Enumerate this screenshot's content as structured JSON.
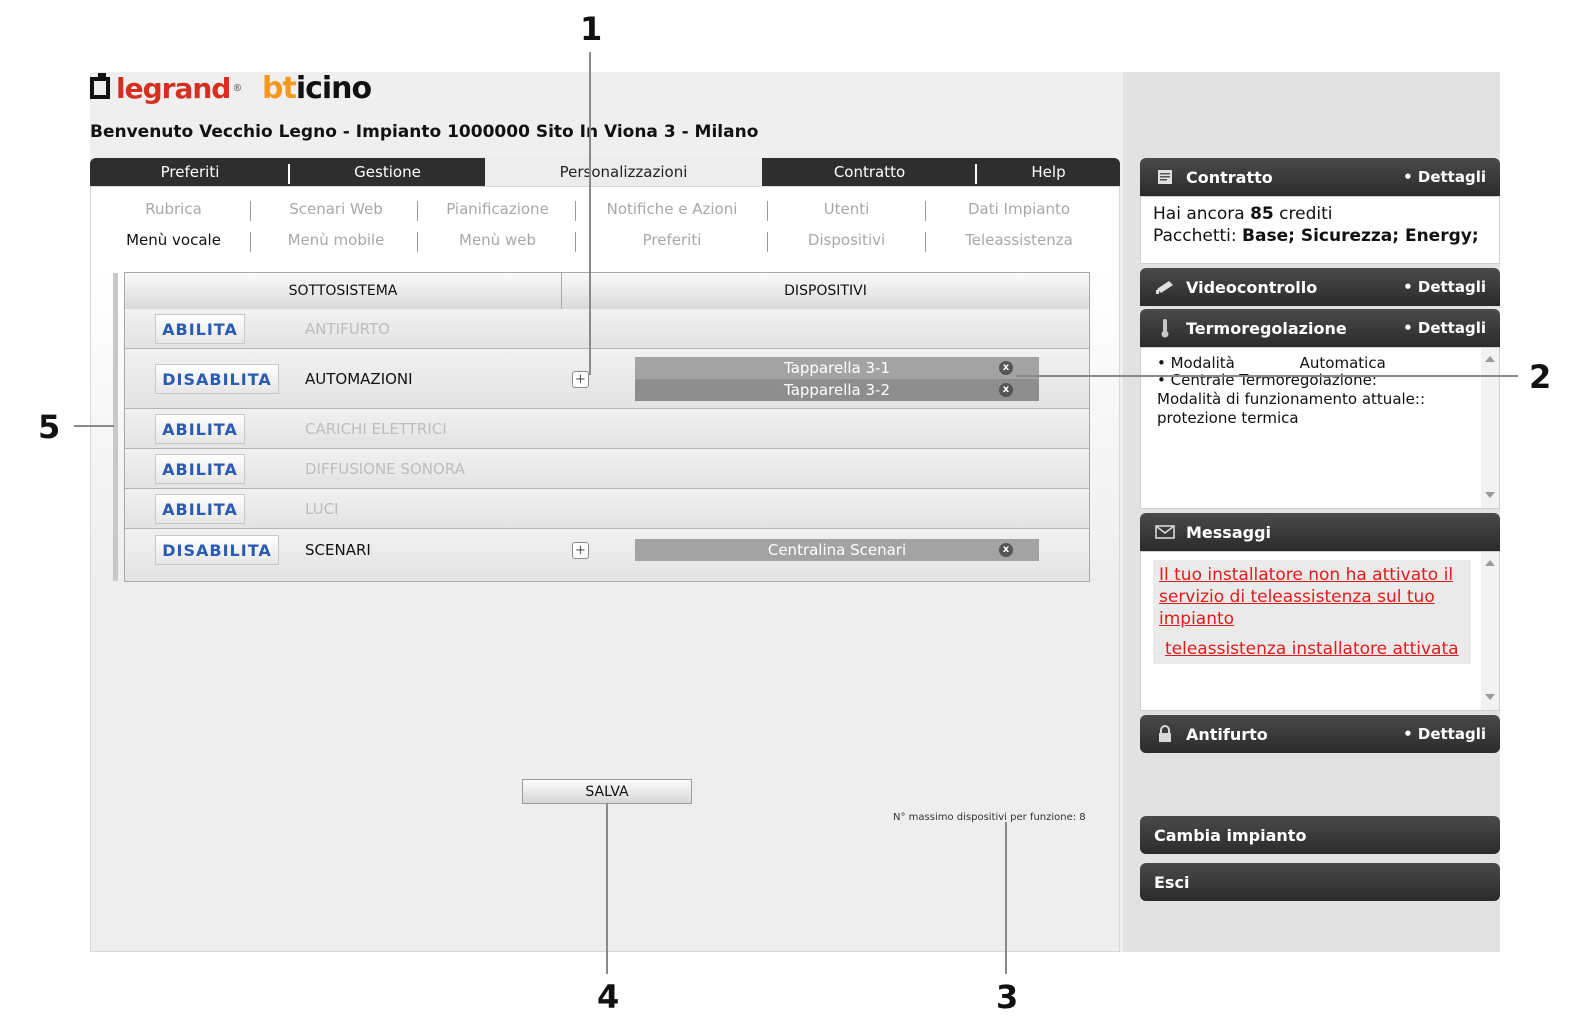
{
  "header": {
    "brand_legrand": "legrand",
    "brand_bticino_b": "bt",
    "brand_bticino_rest": "icino",
    "welcome": "Benvenuto Vecchio Legno - Impianto 1000000 Sito In Viona 3 - Milano"
  },
  "main_tabs": [
    "Preferiti",
    "Gestione",
    "Personalizzazioni",
    "Contratto",
    "Help"
  ],
  "sub_nav": {
    "row1": [
      "Rubrica",
      "Scenari Web",
      "Pianificazione",
      "Notifiche e Azioni",
      "Utenti",
      "Dati Impianto"
    ],
    "row2": [
      "Menù vocale",
      "Menù mobile",
      "Menù web",
      "Preferiti",
      "Dispositivi",
      "Teleassistenza"
    ]
  },
  "table": {
    "col_subsystem": "SOTTOSISTEMA",
    "col_devices": "DISPOSITIVI",
    "rows": [
      {
        "button": "ABILITA",
        "name": "ANTIFURTO"
      },
      {
        "button": "DISABILITA",
        "name": "AUTOMAZIONI",
        "devices": [
          "Tapparella 3-1",
          "Tapparella 3-2"
        ]
      },
      {
        "button": "ABILITA",
        "name": "CARICHI ELETTRICI"
      },
      {
        "button": "ABILITA",
        "name": "DIFFUSIONE SONORA"
      },
      {
        "button": "ABILITA",
        "name": "LUCI"
      },
      {
        "button": "DISABILITA",
        "name": "SCENARI",
        "devices": [
          "Centralina Scenari"
        ]
      }
    ],
    "add_symbol": "+",
    "remove_symbol": "x"
  },
  "save_label": "SALVA",
  "max_note": "N° massimo dispositivi per funzione: 8",
  "sidebar": {
    "contratto": {
      "title": "Contratto",
      "details": "• Dettagli",
      "credits_pre": "Hai ancora",
      "credits_value": "85",
      "credits_post": "crediti",
      "packages_label": "Pacchetti:",
      "packages_value": "Base; Sicurezza; Energy;"
    },
    "videocontrollo": {
      "title": "Videocontrollo",
      "details": "• Dettagli"
    },
    "termoregolazione": {
      "title": "Termoregolazione",
      "details": "• Dettagli",
      "mode_label": "• Modalità",
      "mode_value": "Automatica",
      "central_label": "• Centrale Termoregolazione:",
      "central_line2": "Modalità di funzionamento attuale::",
      "central_line3": "protezione termica"
    },
    "messaggi": {
      "title": "Messaggi",
      "msg1": "Il tuo installatore non ha attivato il servizio di teleassistenza sul tuo impianto",
      "msg2": "teleassistenza installatore attivata"
    },
    "antifurto": {
      "title": "Antifurto",
      "details": "• Dettagli"
    },
    "cambia_impianto": "Cambia impianto",
    "esci": "Esci"
  },
  "annotations": [
    "1",
    "2",
    "3",
    "4",
    "5"
  ],
  "icons": {
    "contratto": "document-icon",
    "videocontrollo": "camera-icon",
    "termoregolazione": "thermometer-icon",
    "messaggi": "envelope-icon",
    "antifurto": "lock-icon"
  }
}
